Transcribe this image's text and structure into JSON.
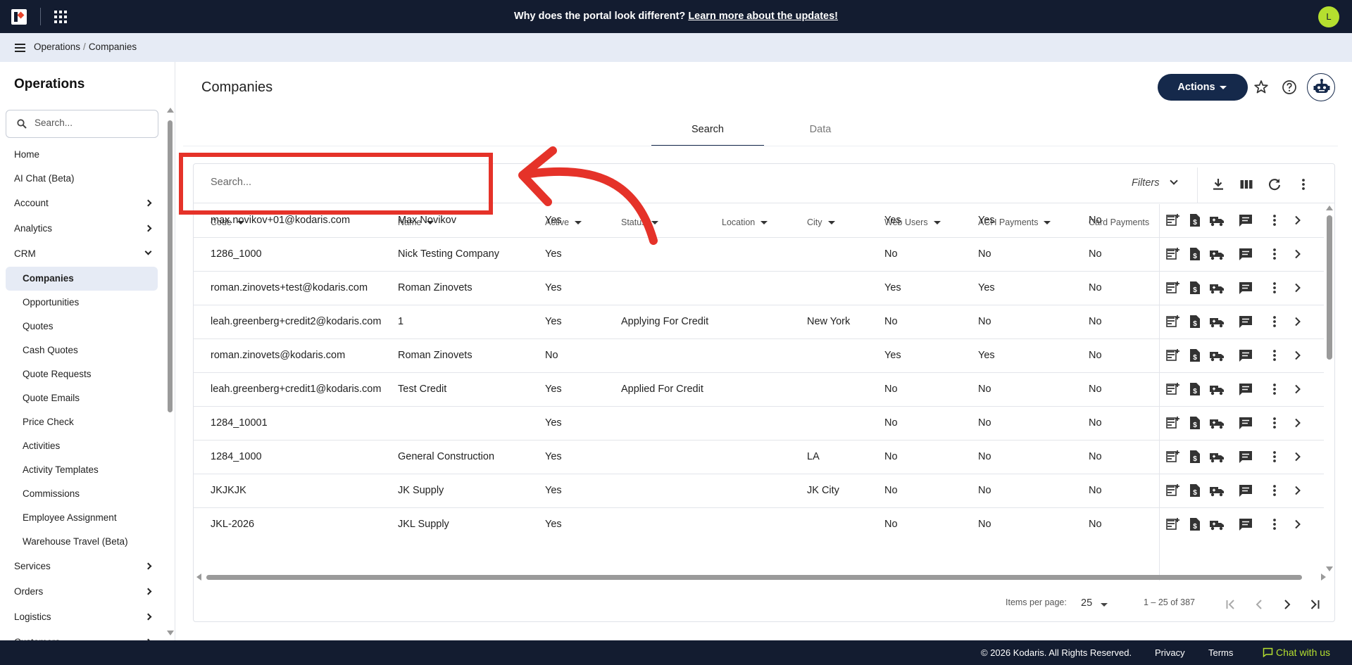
{
  "topbar": {
    "announcement_text": "Why does the portal look different?",
    "announcement_link": "Learn more about the updates!",
    "user_initial": "L"
  },
  "breadcrumb": [
    "Operations",
    "Companies"
  ],
  "sidebar": {
    "title": "Operations",
    "search_placeholder": "Search...",
    "items": [
      {
        "label": "Home",
        "type": "top"
      },
      {
        "label": "AI Chat (Beta)",
        "type": "top"
      },
      {
        "label": "Account",
        "type": "group",
        "state": "collapsed"
      },
      {
        "label": "Analytics",
        "type": "group",
        "state": "collapsed"
      },
      {
        "label": "CRM",
        "type": "group",
        "state": "expanded"
      },
      {
        "label": "Companies",
        "type": "sub",
        "active": true
      },
      {
        "label": "Opportunities",
        "type": "sub"
      },
      {
        "label": "Quotes",
        "type": "sub"
      },
      {
        "label": "Cash Quotes",
        "type": "sub"
      },
      {
        "label": "Quote Requests",
        "type": "sub"
      },
      {
        "label": "Quote Emails",
        "type": "sub"
      },
      {
        "label": "Price Check",
        "type": "sub"
      },
      {
        "label": "Activities",
        "type": "sub"
      },
      {
        "label": "Activity Templates",
        "type": "sub"
      },
      {
        "label": "Commissions",
        "type": "sub"
      },
      {
        "label": "Employee Assignment",
        "type": "sub"
      },
      {
        "label": "Warehouse Travel (Beta)",
        "type": "sub"
      },
      {
        "label": "Services",
        "type": "group",
        "state": "collapsed"
      },
      {
        "label": "Orders",
        "type": "group",
        "state": "collapsed"
      },
      {
        "label": "Logistics",
        "type": "group",
        "state": "collapsed"
      },
      {
        "label": "Customers",
        "type": "group",
        "state": "collapsed"
      }
    ]
  },
  "page": {
    "title": "Companies",
    "actions_label": "Actions",
    "tabs": [
      {
        "label": "Search",
        "active": true
      },
      {
        "label": "Data",
        "active": false
      }
    ]
  },
  "table": {
    "search_placeholder": "Search...",
    "filters_label": "Filters",
    "columns": [
      "Code",
      "Name",
      "Active",
      "Status",
      "Location",
      "City",
      "Web Users",
      "ACH Payments",
      "Card Payments"
    ],
    "rows": [
      [
        "max.novikov+01@kodaris.com",
        "Max Novikov",
        "Yes",
        "",
        "",
        "",
        "Yes",
        "Yes",
        "No"
      ],
      [
        "1286_1000",
        "Nick Testing Company",
        "Yes",
        "",
        "",
        "",
        "No",
        "No",
        "No"
      ],
      [
        "roman.zinovets+test@kodaris.com",
        "Roman Zinovets",
        "Yes",
        "",
        "",
        "",
        "Yes",
        "Yes",
        "No"
      ],
      [
        "leah.greenberg+credit2@kodaris.com",
        "1",
        "Yes",
        "Applying For Credit",
        "",
        "New York",
        "No",
        "No",
        "No"
      ],
      [
        "roman.zinovets@kodaris.com",
        "Roman Zinovets",
        "No",
        "",
        "",
        "",
        "Yes",
        "Yes",
        "No"
      ],
      [
        "leah.greenberg+credit1@kodaris.com",
        "Test Credit",
        "Yes",
        "Applied For Credit",
        "",
        "",
        "No",
        "No",
        "No"
      ],
      [
        "1284_10001",
        "",
        "Yes",
        "",
        "",
        "",
        "No",
        "No",
        "No"
      ],
      [
        "1284_1000",
        "General Construction",
        "Yes",
        "",
        "",
        "LA",
        "No",
        "No",
        "No"
      ],
      [
        "JKJKJK",
        "JK Supply",
        "Yes",
        "",
        "",
        "JK City",
        "No",
        "No",
        "No"
      ],
      [
        "JKL-2026",
        "JKL Supply",
        "Yes",
        "",
        "",
        "",
        "No",
        "No",
        "No"
      ]
    ],
    "pagination": {
      "items_per_page_label": "Items per page:",
      "items_per_page": "25",
      "range": "1 – 25 of 387"
    }
  },
  "footer": {
    "copyright": "© 2026 Kodaris. All Rights Reserved.",
    "privacy": "Privacy",
    "terms": "Terms",
    "chat": "Chat with us"
  },
  "colors": {
    "navy": "#131c30",
    "accent": "#15294b",
    "lime": "#b5df2f",
    "annotation": "#e53229"
  }
}
